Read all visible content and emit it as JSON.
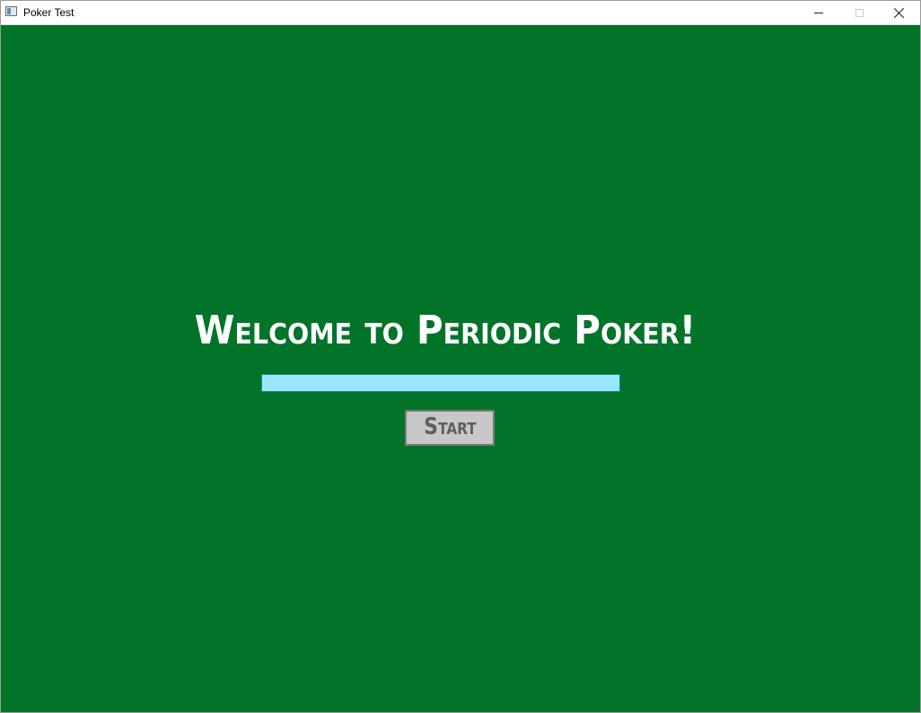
{
  "window": {
    "title": "Poker Test",
    "icons": {
      "app": "app-window-icon",
      "minimize": "minimize-icon",
      "maximize": "maximize-icon",
      "close": "close-icon"
    }
  },
  "main": {
    "welcome_text": "Welcome to Periodic Poker!",
    "name_input": {
      "value": "",
      "placeholder": ""
    },
    "start_label": "Start"
  },
  "colors": {
    "table_green": "#017429",
    "input_background": "#9ae6ff",
    "button_background": "#c8c8c8",
    "button_text": "#5f5f5f",
    "title_text": "#ffffff"
  }
}
